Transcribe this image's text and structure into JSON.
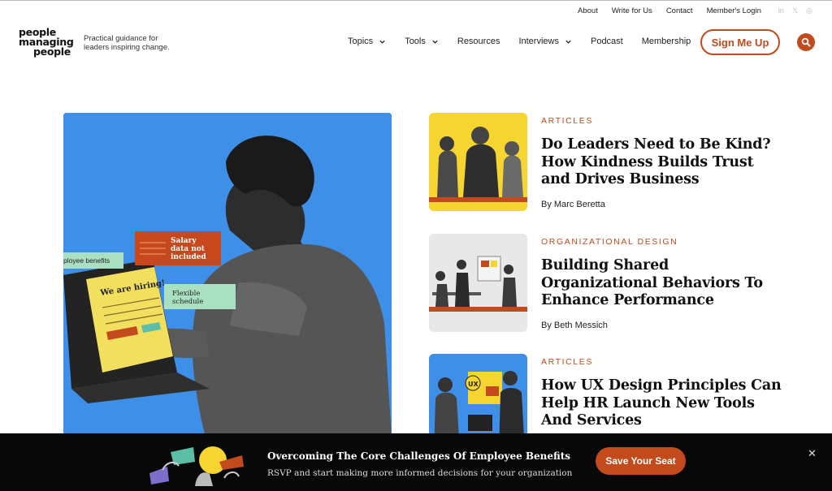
{
  "top_links": [
    "About",
    "Write for Us",
    "Contact",
    "Member's Login"
  ],
  "social": [
    "in",
    "𝕏",
    "◎"
  ],
  "brand": {
    "line1": "people",
    "line2": "managing",
    "line3": "people"
  },
  "tagline": "Practical guidance for leaders inspiring change.",
  "nav": [
    "Topics",
    "Tools",
    "Resources",
    "Interviews",
    "Podcast",
    "Membership"
  ],
  "signup_label": "Sign Me Up",
  "hero": {
    "note_hiring": "We are hiring!",
    "note_salary": "Salary data not included",
    "note_benefits": "ployee benefits",
    "note_flex": "Flexible schedule"
  },
  "articles": [
    {
      "category": "ARTICLES",
      "title": "Do Leaders Need to Be Kind? How Kindness Builds Trust and Drives Business",
      "byline": "By Marc Beretta"
    },
    {
      "category": "ORGANIZATIONAL DESIGN",
      "title": "Building Shared Organizational Behaviors To Enhance Performance",
      "byline": "By Beth Messich"
    },
    {
      "category": "ARTICLES",
      "title": "How UX Design Principles Can Help HR Launch New Tools And Services",
      "byline": ""
    }
  ],
  "thumb3_badge": "UX",
  "banner": {
    "title": "Overcoming The Core Challenges Of Employee Benefits",
    "subtitle": "RSVP and start making more informed decisions for your organization",
    "cta": "Save Your Seat"
  },
  "colors": {
    "accent": "#c34a1c",
    "hero_bg": "#3e8fe8",
    "banner_bg": "#080808",
    "thumb_yellow": "#f7d531"
  }
}
